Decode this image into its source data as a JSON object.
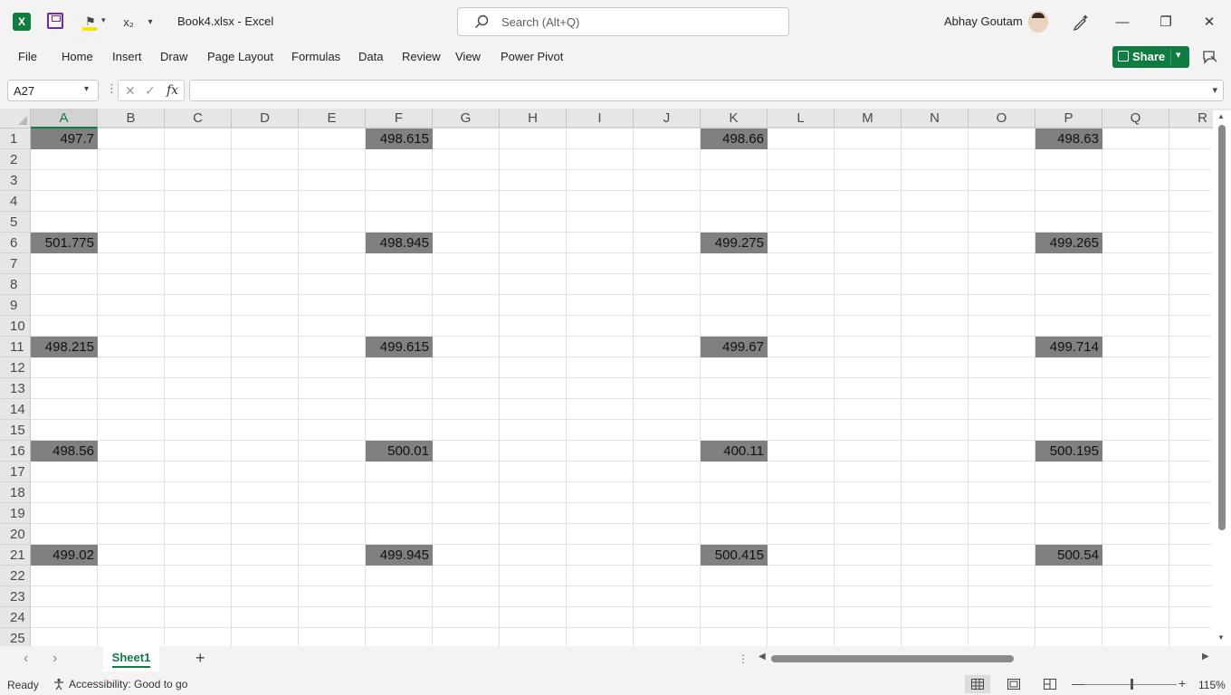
{
  "titlebar": {
    "app_icon_letter": "X",
    "sub_label": "x₂",
    "doc_title": "Book4.xlsx  -  Excel",
    "search_placeholder": "Search (Alt+Q)",
    "user_name": "Abhay Goutam",
    "minimize": "—",
    "restore": "❐",
    "close": "✕"
  },
  "menu": {
    "items": [
      "File",
      "Home",
      "Insert",
      "Draw",
      "Page Layout",
      "Formulas",
      "Data",
      "Review",
      "View",
      "Power Pivot"
    ],
    "share_label": "Share"
  },
  "formula_bar": {
    "name_box": "A27",
    "cancel": "✕",
    "enter": "✓",
    "fx": "fx",
    "formula_value": ""
  },
  "grid": {
    "columns": [
      "A",
      "B",
      "C",
      "D",
      "E",
      "F",
      "G",
      "H",
      "I",
      "J",
      "K",
      "L",
      "M",
      "N",
      "O",
      "P",
      "Q",
      "R"
    ],
    "rows": [
      "1",
      "2",
      "3",
      "4",
      "5",
      "6",
      "7",
      "8",
      "9",
      "10",
      "11",
      "12",
      "13",
      "14",
      "15",
      "16",
      "17",
      "18",
      "19",
      "20",
      "21",
      "22",
      "23",
      "24",
      "25"
    ],
    "selected_column": "A",
    "cell_fill": "#808080",
    "values": {
      "A": [
        "497.7",
        "501.775",
        "498.215",
        "498.56",
        "499.02"
      ],
      "F": [
        "498.615",
        "498.945",
        "499.615",
        "500.01",
        "499.945"
      ],
      "K": [
        "498.66",
        "499.275",
        "499.67",
        "400.11",
        "500.415"
      ],
      "P": [
        "498.63",
        "499.265",
        "499.714",
        "500.195",
        "500.54"
      ]
    },
    "value_rows": [
      "1",
      "6",
      "11",
      "16",
      "21"
    ]
  },
  "sheets": {
    "tabs": [
      "Sheet1"
    ],
    "add": "+"
  },
  "status": {
    "ready": "Ready",
    "accessibility": "Accessibility: Good to go",
    "zoom_minus": "—",
    "zoom_plus": "+",
    "zoom_level": "115%",
    "zoom_fraction": 0.5
  },
  "colors": {
    "accent": "#107c41",
    "chrome": "#f3f3f3",
    "header": "#e6e6e6"
  }
}
